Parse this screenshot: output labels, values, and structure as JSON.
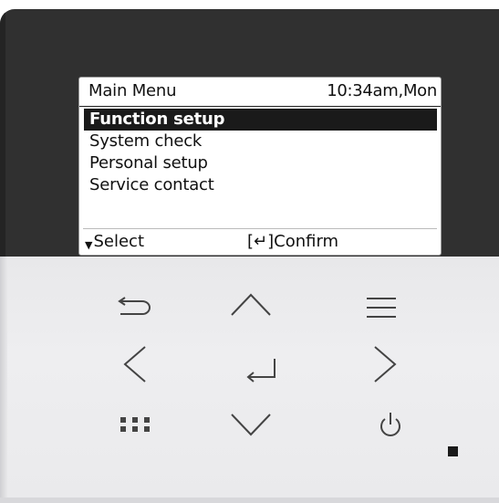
{
  "screen": {
    "title": "Main Menu",
    "clock": "10:34am,Mon",
    "menu_items": [
      {
        "label": "Function setup",
        "selected": true
      },
      {
        "label": "System check",
        "selected": false
      },
      {
        "label": "Personal setup",
        "selected": false
      },
      {
        "label": "Service contact",
        "selected": false
      }
    ],
    "footer": {
      "select_label": "Select",
      "confirm_label": "[↵]Confirm"
    }
  },
  "keypad": {
    "keys": [
      {
        "name": "back-button",
        "icon": "back-arrow-icon"
      },
      {
        "name": "up-button",
        "icon": "chevron-up-icon"
      },
      {
        "name": "menu-button",
        "icon": "menu-lines-icon"
      },
      {
        "name": "left-button",
        "icon": "chevron-left-icon"
      },
      {
        "name": "enter-button",
        "icon": "enter-return-icon"
      },
      {
        "name": "right-button",
        "icon": "chevron-right-icon"
      },
      {
        "name": "grid-button",
        "icon": "dot-grid-icon"
      },
      {
        "name": "down-button",
        "icon": "chevron-down-icon"
      },
      {
        "name": "power-button",
        "icon": "power-icon"
      }
    ]
  },
  "colors": {
    "housing_top": "#303030",
    "housing_bottom": "#ebebed",
    "selection_bg": "#1a1a1a",
    "key_stroke": "#444444"
  }
}
